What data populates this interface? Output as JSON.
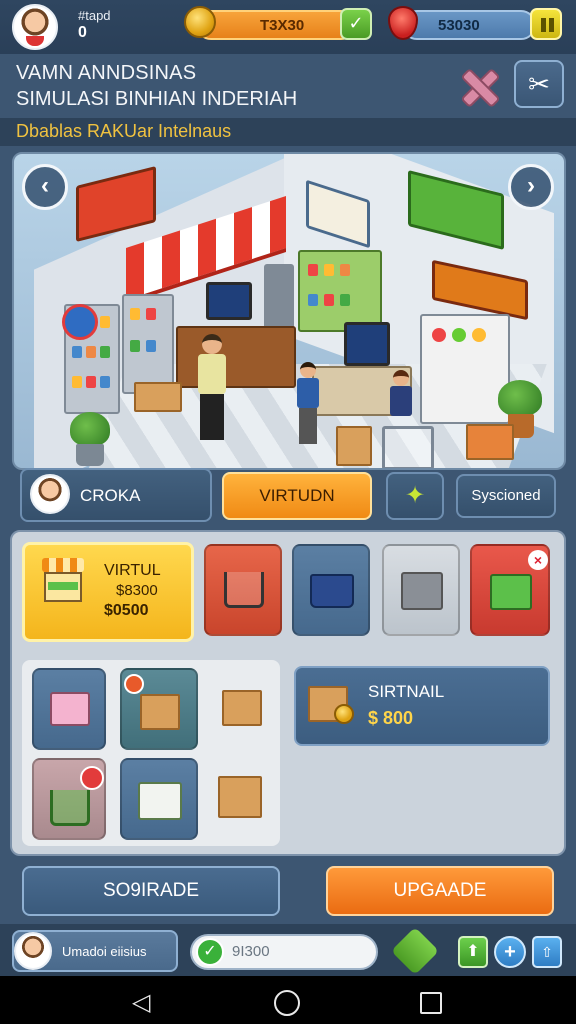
{
  "player": {
    "tag": "#tapd",
    "level": "0"
  },
  "currency": {
    "coins": "T3X30",
    "coin_add": "✓",
    "gems": "53030"
  },
  "header": {
    "title_line1": "VAMN ANNDSINAS",
    "title_line2": "SIMULASI BINHIAN INDERIAH",
    "subtitle": "Dbablas RAKUar Intelnaus"
  },
  "scene": {
    "left_arrow": "‹",
    "right_arrow": "›"
  },
  "tabs": {
    "profile_label": "CROKA",
    "virtual_label": "VIRTUDN",
    "boost_icon": "✦",
    "synced_label": "Syscioned"
  },
  "featured_card": {
    "label": "VIRTUL",
    "price": "$8300",
    "cost": "$0500"
  },
  "item_tiles": [
    {
      "name": "cart-red",
      "icon": "shopping-cart-icon"
    },
    {
      "name": "basket",
      "icon": "basket-icon"
    },
    {
      "name": "hamper",
      "icon": "hamper-icon"
    },
    {
      "name": "crate",
      "icon": "crate-icon",
      "badge": "×"
    }
  ],
  "sirtnail": {
    "label": "SIRTNAIL",
    "price": "$ 800"
  },
  "buttons": {
    "secondary": "SO9IRADE",
    "upgrade": "UPGAADE"
  },
  "footer": {
    "name": "Umadoi eiisius",
    "score": "9I300",
    "check": "✓",
    "up": "⬆",
    "plus": "+",
    "share": "⇧"
  },
  "android_nav": {
    "back": "◁"
  },
  "colors": {
    "accent_orange": "#f08a14",
    "panel_blue": "#3d5672",
    "gold": "#ffd54a"
  }
}
